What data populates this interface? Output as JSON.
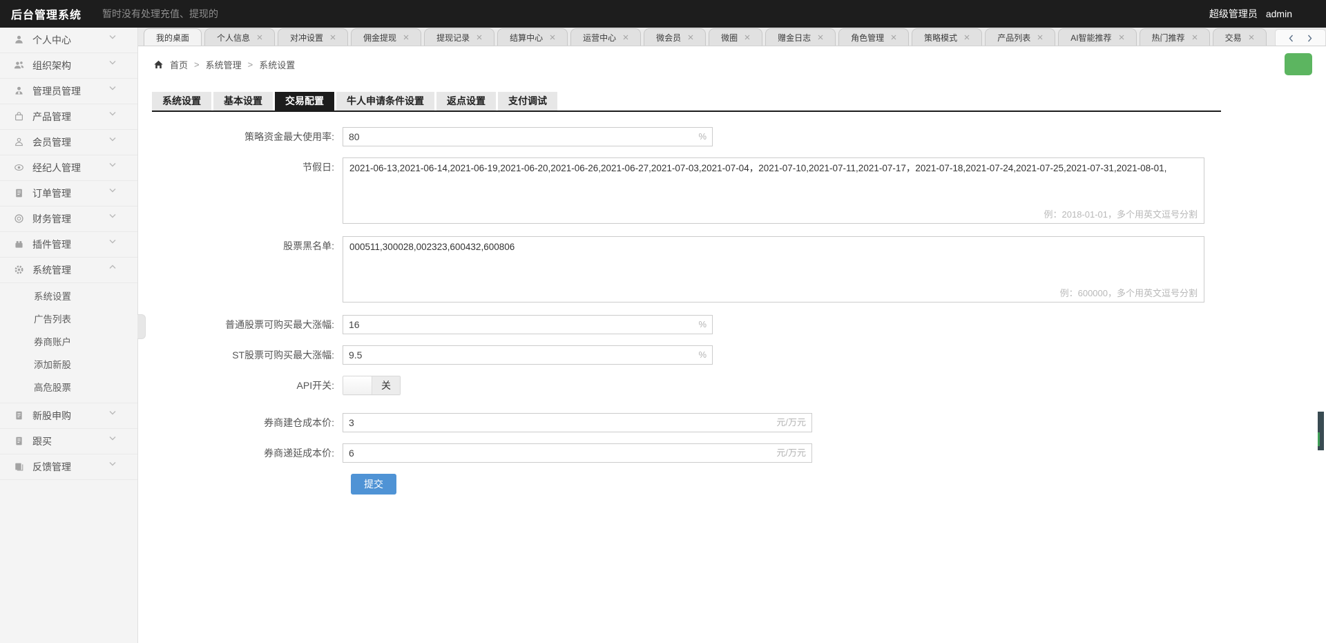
{
  "topbar": {
    "title": "后台管理系统",
    "notice": "暂时没有处理充值、提现的",
    "role": "超级管理员",
    "username": "admin",
    "user_caret_icon": "chevron-down-icon",
    "skin_icon": "skin-icon"
  },
  "tab_bar": {
    "tabs": [
      {
        "label": "我的桌面",
        "closable": false,
        "active": true
      },
      {
        "label": "个人信息",
        "closable": true
      },
      {
        "label": "对冲设置",
        "closable": true
      },
      {
        "label": "佣金提现",
        "closable": true
      },
      {
        "label": "提现记录",
        "closable": true
      },
      {
        "label": "结算中心",
        "closable": true
      },
      {
        "label": "运营中心",
        "closable": true
      },
      {
        "label": "微会员",
        "closable": true
      },
      {
        "label": "微圈",
        "closable": true
      },
      {
        "label": "赠金日志",
        "closable": true
      },
      {
        "label": "角色管理",
        "closable": true
      },
      {
        "label": "策略模式",
        "closable": true
      },
      {
        "label": "产品列表",
        "closable": true
      },
      {
        "label": "AI智能推荐",
        "closable": true
      },
      {
        "label": "热门推荐",
        "closable": true
      },
      {
        "label": "交易",
        "closable": true
      }
    ],
    "scroll_left_icon": "chevron-left-icon",
    "scroll_right_icon": "chevron-right-icon"
  },
  "breadcrumb": {
    "home_icon": "home-icon",
    "separator": ">",
    "items": [
      "首页",
      "系统管理",
      "系统设置"
    ]
  },
  "toolbar": {
    "refresh_icon": "refresh-icon",
    "refresh_color": "#5cb560"
  },
  "sidebar": {
    "items": [
      {
        "key": "personal-center",
        "label": "个人中心",
        "icon": "user-icon"
      },
      {
        "key": "org-structure",
        "label": "组织架构",
        "icon": "users-icon"
      },
      {
        "key": "admin-manage",
        "label": "管理员管理",
        "icon": "admin-icon"
      },
      {
        "key": "product-manage",
        "label": "产品管理",
        "icon": "bag-icon"
      },
      {
        "key": "member-manage",
        "label": "会员管理",
        "icon": "member-icon"
      },
      {
        "key": "broker-manage",
        "label": "经纪人管理",
        "icon": "broker-icon"
      },
      {
        "key": "order-manage",
        "label": "订单管理",
        "icon": "order-icon"
      },
      {
        "key": "finance-manage",
        "label": "财务管理",
        "icon": "finance-icon"
      },
      {
        "key": "plugin-manage",
        "label": "插件管理",
        "icon": "plugin-icon"
      },
      {
        "key": "system-manage",
        "label": "系统管理",
        "icon": "gear-icon",
        "expanded": true,
        "children": [
          {
            "key": "system-settings",
            "label": "系统设置"
          },
          {
            "key": "ad-list",
            "label": "广告列表"
          },
          {
            "key": "broker-account",
            "label": "券商账户"
          },
          {
            "key": "add-new-stock",
            "label": "添加新股"
          },
          {
            "key": "high-risk-stock",
            "label": "高危股票"
          }
        ]
      },
      {
        "key": "ipo-subscribe",
        "label": "新股申购",
        "icon": "doc-icon"
      },
      {
        "key": "follow-buy",
        "label": "跟买",
        "icon": "doc-icon"
      },
      {
        "key": "feedback-manage",
        "label": "反馈管理",
        "icon": "feedback-icon"
      }
    ]
  },
  "form_tabs": {
    "active_index": 2,
    "items": [
      "系统设置",
      "基本设置",
      "交易配置",
      "牛人申请条件设置",
      "返点设置",
      "支付调试"
    ]
  },
  "form": {
    "fields": [
      {
        "name": "max-usage-rate",
        "type": "input",
        "size": "medium",
        "label": "策略资金最大使用率:",
        "value": "80",
        "suffix": "%"
      },
      {
        "name": "holidays",
        "type": "textarea",
        "label": "节假日:",
        "value": "2021-06-13,2021-06-14,2021-06-19,2021-06-20,2021-06-26,2021-06-27,2021-07-03,2021-07-04，2021-07-10,2021-07-11,2021-07-17，2021-07-18,2021-07-24,2021-07-25,2021-07-31,2021-08-01,",
        "hint": "例：2018-01-01，多个用英文逗号分割"
      },
      {
        "name": "stock-blacklist",
        "type": "textarea",
        "label": "股票黑名单:",
        "value": "000511,300028,002323,600432,600806",
        "hint": "例：600000，多个用英文逗号分割"
      },
      {
        "name": "normal-stock-max-rise",
        "type": "input",
        "size": "medium",
        "label": "普通股票可购买最大涨幅:",
        "value": "16",
        "suffix": "%"
      },
      {
        "name": "st-stock-max-rise",
        "type": "input",
        "size": "medium",
        "label": "ST股票可购买最大涨幅:",
        "value": "9.5",
        "suffix": "%"
      },
      {
        "name": "api-switch",
        "type": "toggle",
        "label": "API开关:",
        "state": "off",
        "off_label": "关"
      },
      {
        "name": "broker-open-cost",
        "type": "input",
        "size": "wide",
        "label": "券商建仓成本价:",
        "value": "3",
        "suffix": "元/万元"
      },
      {
        "name": "broker-defer-cost",
        "type": "input",
        "size": "wide",
        "label": "券商递延成本价:",
        "value": "6",
        "suffix": "元/万元"
      }
    ],
    "submit_label": "提交",
    "submit_color": "#4f93d5"
  }
}
